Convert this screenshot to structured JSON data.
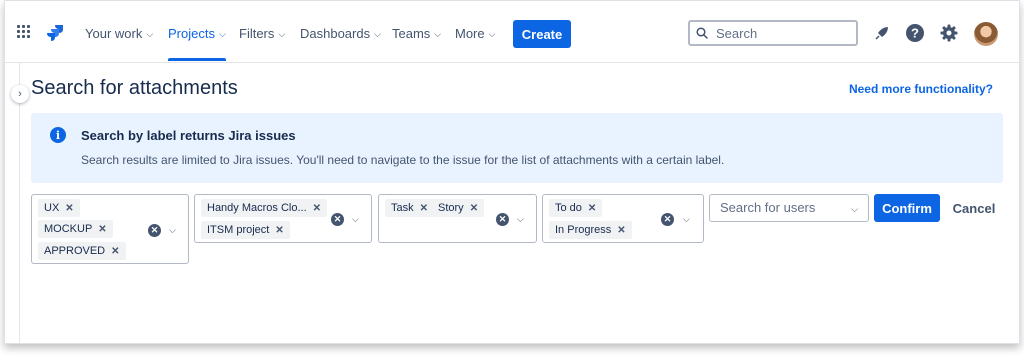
{
  "nav": {
    "items": [
      {
        "label": "Your work"
      },
      {
        "label": "Projects"
      },
      {
        "label": "Filters"
      },
      {
        "label": "Dashboards"
      },
      {
        "label": "Teams"
      },
      {
        "label": "More"
      }
    ],
    "active": "Projects",
    "create_label": "Create",
    "search_placeholder": "Search",
    "icons": [
      "app-switcher-icon",
      "jira-logo-icon",
      "notifications-icon",
      "help-icon",
      "settings-icon",
      "avatar"
    ]
  },
  "page": {
    "title": "Search for attachments",
    "more_link": "Need more functionality?"
  },
  "banner": {
    "title": "Search by label returns Jira issues",
    "text": "Search results are limited to Jira issues. You'll need to navigate to the issue for the list of attachments with a certain label."
  },
  "filters": {
    "labels": [
      "UX",
      "MOCKUP",
      "APPROVED"
    ],
    "projects": [
      "Handy Macros Clo...",
      "ITSM project"
    ],
    "types": [
      "Task",
      "Story"
    ],
    "statuses": [
      "To do",
      "In Progress"
    ],
    "users_placeholder": "Search for users"
  },
  "actions": {
    "confirm_label": "Confirm",
    "cancel_label": "Cancel"
  },
  "colors": {
    "accent": "#0c66e4",
    "banner_bg": "#e9f2ff",
    "text": "#172b4d"
  }
}
